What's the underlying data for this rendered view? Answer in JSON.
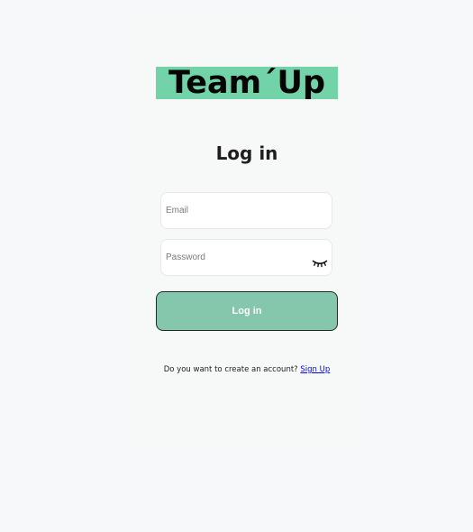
{
  "app": {
    "logo_text": "Team´Up"
  },
  "login": {
    "title": "Log in",
    "email_placeholder": "Email",
    "email_value": "",
    "password_placeholder": "Password",
    "password_value": "",
    "password_toggle_icon": "eye-closed-icon",
    "submit_label": "Log in"
  },
  "signup": {
    "prompt": "Do you want to create an account?",
    "link_label": "Sign Up"
  },
  "colors": {
    "background": "#f7f8fa",
    "card": "#f6f9f8",
    "logo_bg": "#72d2a8",
    "button_bg": "#84c7ad",
    "link": "#0000ee"
  }
}
